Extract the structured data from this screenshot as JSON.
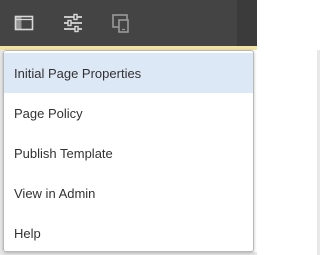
{
  "toolbar": {
    "background": "#444444",
    "icons": [
      {
        "name": "toggle-side-panel-icon"
      },
      {
        "name": "page-properties-icon"
      },
      {
        "name": "emulator-icon"
      }
    ]
  },
  "menu": {
    "selected_background": "#dde8f7",
    "items": [
      {
        "label": "Initial Page Properties",
        "selected": true
      },
      {
        "label": "Page Policy",
        "selected": false
      },
      {
        "label": "Publish Template",
        "selected": false
      },
      {
        "label": "View in Admin",
        "selected": false
      },
      {
        "label": "Help",
        "selected": false
      }
    ]
  }
}
